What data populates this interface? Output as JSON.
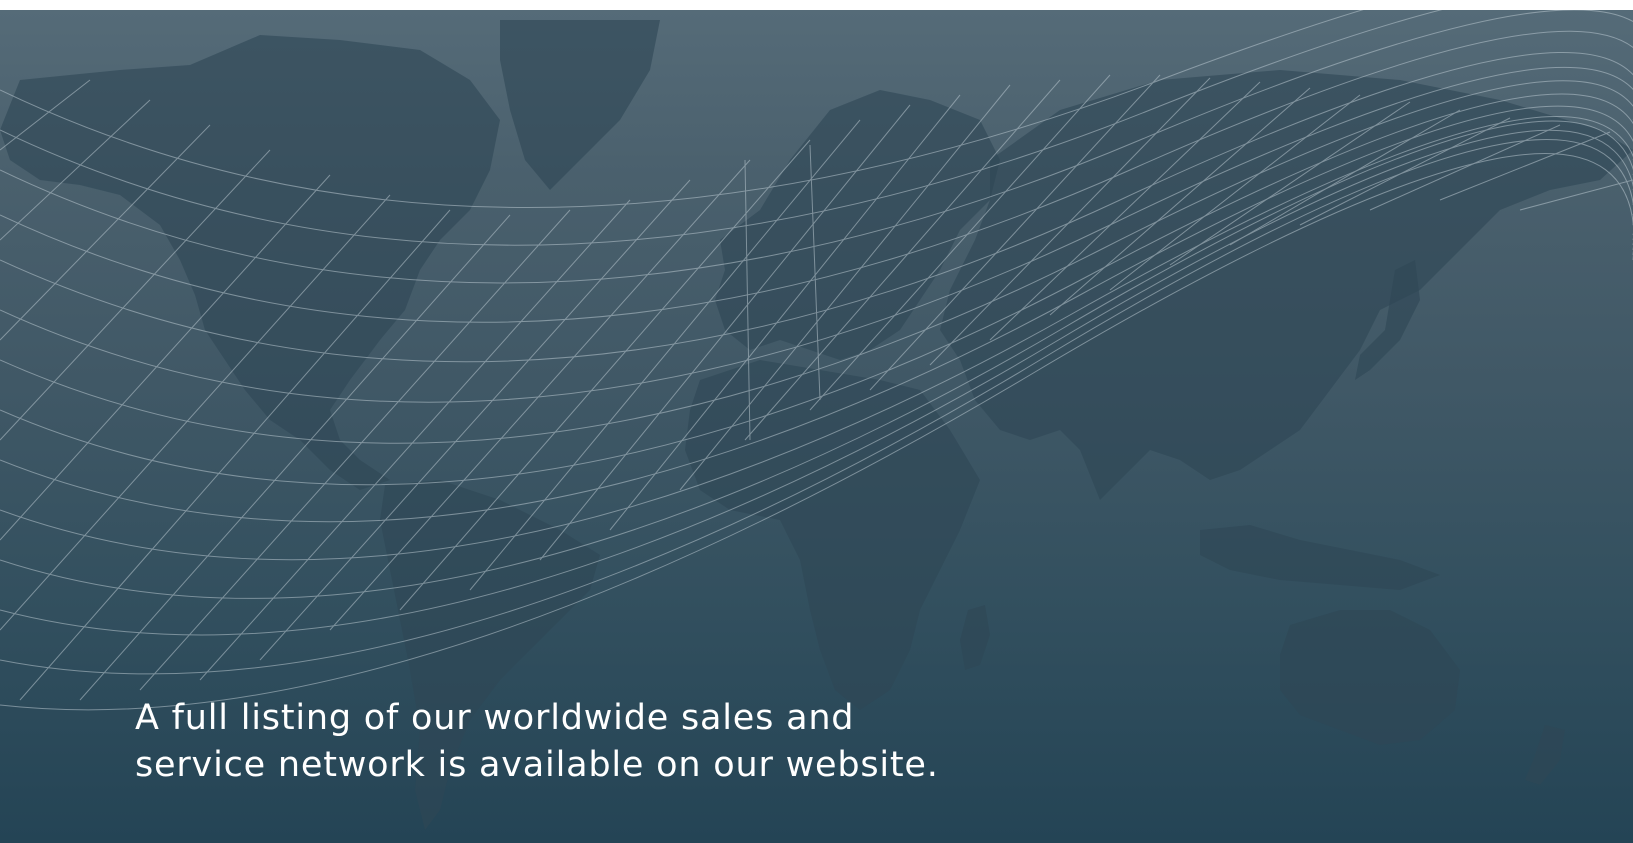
{
  "banner": {
    "tagline_line1": "A full listing of our worldwide sales and",
    "tagline_line2": "service network is available on our website."
  },
  "colors": {
    "background_top": "#556b78",
    "background_bottom": "#244455",
    "landmass": "#2f4756",
    "grid_lines": "#b9c7cf",
    "text": "#ffffff"
  },
  "icons": {
    "map": "world-map-icon"
  }
}
